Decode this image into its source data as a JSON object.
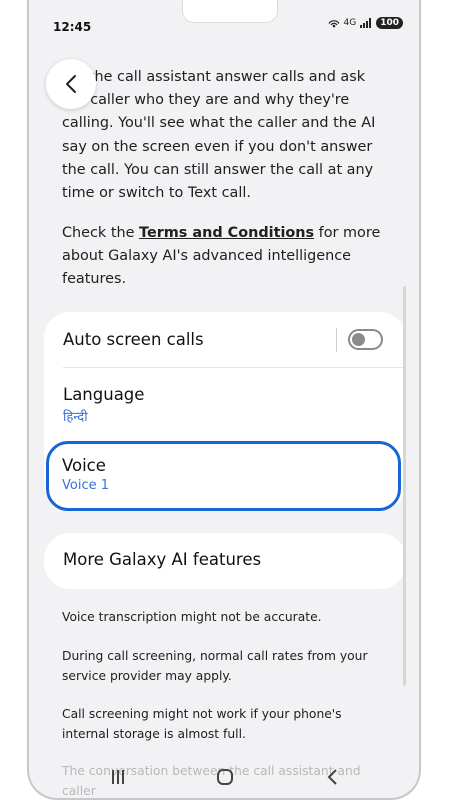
{
  "status_bar": {
    "time": "12:45",
    "network": "4G",
    "battery": "100"
  },
  "intro_text": "Let the call assistant answer calls and ask the caller who they are and why they're calling. You'll see what the caller and the AI say on the screen even if you don't answer the call. You can still answer the call at any time or switch to Text call.",
  "terms": {
    "prefix": "Check the ",
    "link": "Terms and Conditions",
    "suffix": " for more about Galaxy AI's advanced intelligence features."
  },
  "settings": {
    "auto_screen": {
      "label": "Auto screen calls",
      "enabled": false
    },
    "language": {
      "label": "Language",
      "value": "हिन्दी"
    },
    "voice": {
      "label": "Voice",
      "value": "Voice 1"
    }
  },
  "more": {
    "label": "More Galaxy AI features"
  },
  "notes": [
    "Voice transcription might not be accurate.",
    "During call screening, normal call rates from your service provider may apply.",
    "Call screening might not work if your phone's internal storage is almost full.",
    "The conversation between the call assistant and caller"
  ],
  "colors": {
    "accent": "#1666d6",
    "link_blue": "#3a6fd8",
    "background": "#f2f2f5"
  },
  "nav_icons": [
    "recents-icon",
    "home-icon",
    "back-icon"
  ]
}
